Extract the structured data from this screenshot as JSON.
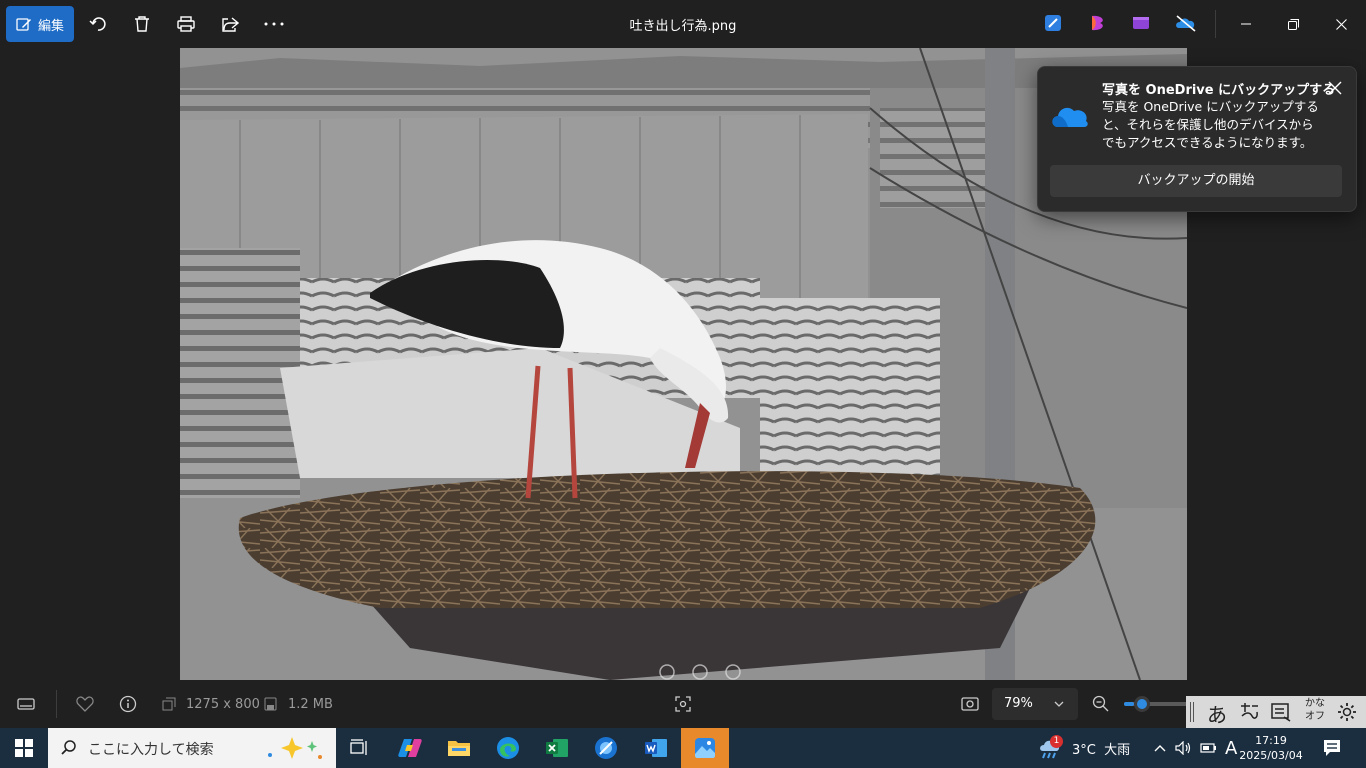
{
  "toolbar": {
    "edit_label": "編集",
    "file_title": "吐き出し行為.png",
    "icons": [
      "rotate-icon",
      "delete-icon",
      "print-icon",
      "share-icon",
      "more-icon"
    ]
  },
  "toast": {
    "title": "写真を OneDrive にバックアップする",
    "body": "写真を OneDrive にバックアップすると、それらを保護し他のデバイスからでもアクセスできるようになります。",
    "action": "バックアップの開始"
  },
  "statusbar": {
    "dimensions": "1275 x 800",
    "file_size": "1.2 MB",
    "zoom": "79%",
    "zoom_level": 0.15
  },
  "ime": {
    "hiragana": "あ",
    "kana_line1": "かな",
    "kana_line2": "オフ"
  },
  "taskbar": {
    "search_placeholder": "ここに入力して検索",
    "weather": "3°C  大雨",
    "weather_badge": "1",
    "ime_mode": "A",
    "time": "17:19",
    "date": "2025/03/04"
  },
  "colors": {
    "accent": "#1f6cc7",
    "taskbar": "#1b2e40",
    "photos_active": "#e8892b"
  }
}
